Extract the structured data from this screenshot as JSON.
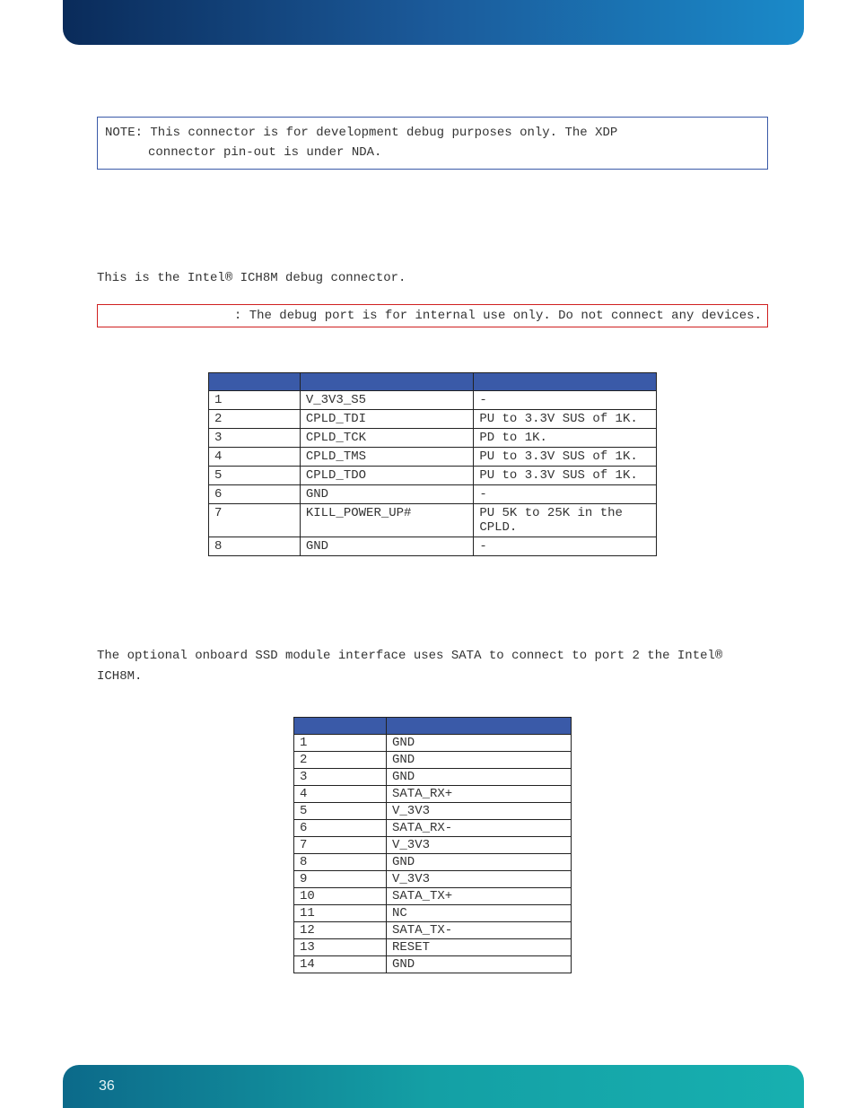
{
  "note": {
    "line1": "NOTE: This connector is for development debug purposes only. The XDP",
    "line2": "connector pin-out is under NDA."
  },
  "section1": {
    "para": "This is the Intel® ICH8M debug connector.",
    "warning": ": The debug port is for internal use only. Do not connect any devices."
  },
  "table1": {
    "headers": [
      "",
      "",
      ""
    ],
    "rows": [
      {
        "pin": "1",
        "signal": "V_3V3_S5",
        "notes": "-"
      },
      {
        "pin": "2",
        "signal": "CPLD_TDI",
        "notes": "PU to 3.3V SUS of 1K."
      },
      {
        "pin": "3",
        "signal": "CPLD_TCK",
        "notes": "PD to 1K."
      },
      {
        "pin": "4",
        "signal": "CPLD_TMS",
        "notes": "PU to 3.3V SUS of 1K."
      },
      {
        "pin": "5",
        "signal": "CPLD_TDO",
        "notes": "PU to 3.3V SUS of 1K."
      },
      {
        "pin": "6",
        "signal": "GND",
        "notes": "-"
      },
      {
        "pin": "7",
        "signal": "KILL_POWER_UP#",
        "notes": "PU 5K to 25K in the CPLD."
      },
      {
        "pin": "8",
        "signal": "GND",
        "notes": "-"
      }
    ]
  },
  "section2": {
    "para": "The optional onboard SSD module interface uses SATA to connect to port 2 the Intel® ICH8M."
  },
  "table2": {
    "headers": [
      "",
      ""
    ],
    "rows": [
      {
        "pin": "1",
        "signal": "GND"
      },
      {
        "pin": "2",
        "signal": "GND"
      },
      {
        "pin": "3",
        "signal": "GND"
      },
      {
        "pin": "4",
        "signal": "SATA_RX+"
      },
      {
        "pin": "5",
        "signal": "V_3V3"
      },
      {
        "pin": "6",
        "signal": "SATA_RX-"
      },
      {
        "pin": "7",
        "signal": "V_3V3"
      },
      {
        "pin": "8",
        "signal": "GND"
      },
      {
        "pin": "9",
        "signal": "V_3V3"
      },
      {
        "pin": "10",
        "signal": "SATA_TX+"
      },
      {
        "pin": "11",
        "signal": "NC"
      },
      {
        "pin": "12",
        "signal": "SATA_TX-"
      },
      {
        "pin": "13",
        "signal": "RESET"
      },
      {
        "pin": "14",
        "signal": "GND"
      }
    ]
  },
  "page_number": "36"
}
